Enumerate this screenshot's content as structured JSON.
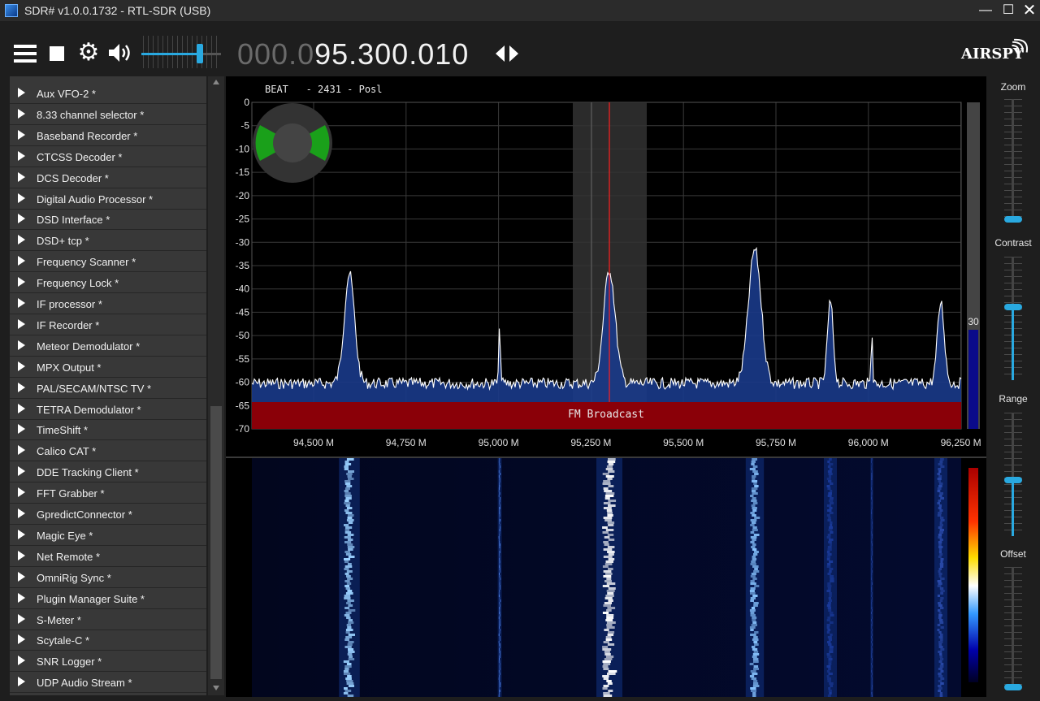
{
  "window": {
    "title": "SDR# v1.0.0.1732 - RTL-SDR (USB)",
    "minimize": "—",
    "maximize": "☐",
    "close": "✕"
  },
  "toolbar": {
    "freq_dim": "000.0",
    "freq_bright": "95.300.010",
    "volume_level": 0.72,
    "logo": "AIRSPY"
  },
  "plugins": [
    "Aux VFO-2 *",
    "8.33 channel selector *",
    "Baseband Recorder *",
    "CTCSS Decoder *",
    "DCS Decoder *",
    "Digital Audio Processor *",
    "DSD Interface *",
    "DSD+ tcp *",
    "Frequency Scanner *",
    "Frequency Lock *",
    "IF processor *",
    "IF Recorder *",
    "Meteor Demodulator *",
    "MPX Output *",
    "PAL/SECAM/NTSC TV *",
    "TETRA Demodulator *",
    "TimeShift *",
    "Calico CAT *",
    "DDE Tracking Client *",
    "FFT Grabber *",
    "GpredictConnector *",
    "Magic Eye *",
    "Net Remote *",
    "OmniRig Sync *",
    "Plugin Manager Suite *",
    "S-Meter *",
    "Scytale-C *",
    "SNR Logger *",
    "UDP Audio Stream *"
  ],
  "spectrum": {
    "header": "BEAT   - 2431 - Posl",
    "band_label": "FM Broadcast",
    "level_value": "30",
    "y_ticks": [
      "0",
      "-5",
      "-10",
      "-15",
      "-20",
      "-25",
      "-30",
      "-35",
      "-40",
      "-45",
      "-50",
      "-55",
      "-60",
      "-65",
      "-70"
    ],
    "x_ticks": [
      "94,500 M",
      "94,750 M",
      "95,000 M",
      "95,250 M",
      "95,500 M",
      "95,750 M",
      "96,000 M",
      "96,250 M"
    ],
    "colors": {
      "fill": "#1a3a8a",
      "line": "#ffffff",
      "band": "#8a0008",
      "tuning": "#ff2020"
    }
  },
  "right_panel": {
    "zoom_label": "Zoom",
    "contrast_label": "Contrast",
    "range_label": "Range",
    "offset_label": "Offset",
    "zoom_level": 0.0,
    "contrast_level": 0.6,
    "range_level": 0.45,
    "offset_level": 0.0
  }
}
